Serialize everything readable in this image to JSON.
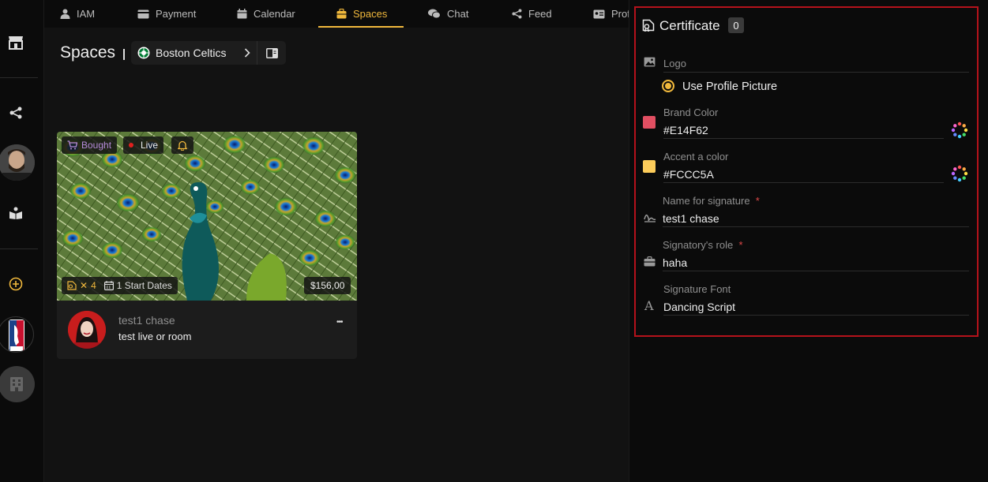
{
  "nav": {
    "tabs": [
      {
        "label": "IAM",
        "icon": "user-icon"
      },
      {
        "label": "Payment",
        "icon": "card-icon"
      },
      {
        "label": "Calendar",
        "icon": "calendar-icon"
      },
      {
        "label": "Spaces",
        "icon": "briefcase-icon",
        "active": true
      },
      {
        "label": "Chat",
        "icon": "chat-icon"
      },
      {
        "label": "Feed",
        "icon": "share-icon"
      },
      {
        "label": "Prof",
        "icon": "id-card-icon"
      }
    ]
  },
  "page": {
    "title": "Spaces",
    "breadcrumb": "Boston Celtics"
  },
  "card": {
    "bought_label": "Bought",
    "live_label": "Live",
    "count_label": "4",
    "dates_label": "1 Start Dates",
    "price": "$156,00",
    "author": "test1 chase",
    "room_title": "test live or room",
    "menu_label": "•••"
  },
  "certificate": {
    "title": "Certificate",
    "count": "0",
    "logo_label": "Logo",
    "use_profile_label": "Use Profile Picture",
    "brand_color_label": "Brand Color",
    "brand_color_value": "#E14F62",
    "accent_color_label": "Accent a color",
    "accent_color_value": "#FCCC5A",
    "signature_name_label": "Name for signature",
    "signature_name_value": "test1 chase",
    "signatory_role_label": "Signatory's role",
    "signatory_role_value": "haha",
    "signature_font_label": "Signature Font",
    "signature_font_value": "Dancing Script",
    "required_mark": "*"
  },
  "colors": {
    "accent": "#F0B83C",
    "brand": "#E14F62",
    "accent_swatch": "#FCCC5A",
    "border": "#B5121B"
  }
}
